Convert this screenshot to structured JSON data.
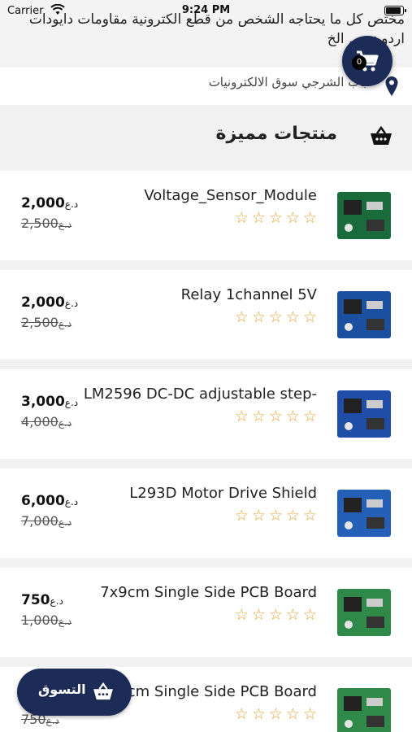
{
  "status_bar": {
    "carrier": "Carrier",
    "time": "9:24 PM",
    "battery_level": 0.95
  },
  "header": {
    "tagline": "مختص كل ما يحتاجه الشخص من قطع الكترونية مقاومات دايودات اردوينو ... الخ",
    "location": "باب الشرجي سوق الالكترونيات"
  },
  "cart": {
    "count": "0",
    "icon": "cart-icon"
  },
  "section": {
    "title": "منتجات مميزة",
    "icon": "basket-icon"
  },
  "currency": "د.ع",
  "products": [
    {
      "name": "Voltage_Sensor_Module",
      "price": "2,000",
      "old_price": "2,500",
      "rating": 0,
      "thumb_color": "#1a6b3c"
    },
    {
      "name": "Relay 1channel 5V",
      "price": "2,000",
      "old_price": "2,500",
      "rating": 0,
      "thumb_color": "#1b4fa0"
    },
    {
      "name": "LM2596 DC-DC adjustable step-",
      "price": "3,000",
      "old_price": "4,000",
      "rating": 0,
      "thumb_color": "#1f4da8"
    },
    {
      "name": "L293D Motor Drive Shield",
      "price": "6,000",
      "old_price": "7,000",
      "rating": 0,
      "thumb_color": "#2460b8"
    },
    {
      "name": "7x9cm Single Side PCB Board",
      "price": "750",
      "old_price": "1,000",
      "rating": 0,
      "thumb_color": "#2f8a4a"
    },
    {
      "name": "cm Single Side PCB Board",
      "price": "",
      "old_price": "750",
      "rating": 0,
      "thumb_color": "#2f8a4a"
    }
  ],
  "shop_button": {
    "label": "التسوق",
    "icon": "basket-icon"
  }
}
